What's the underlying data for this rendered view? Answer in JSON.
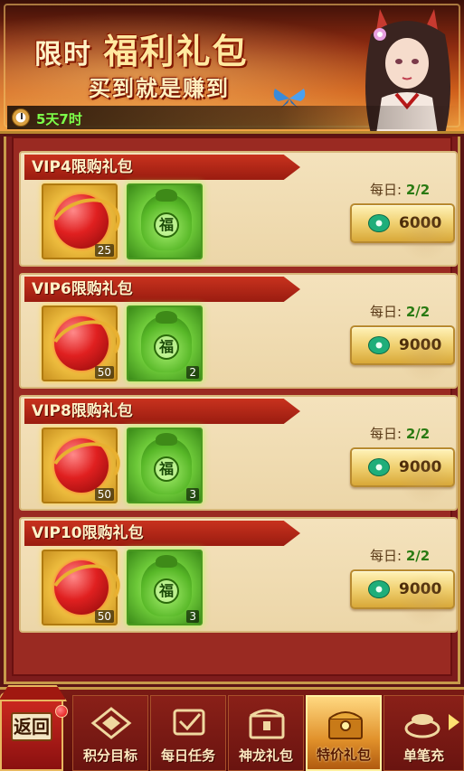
{
  "banner": {
    "title_prefix": "限时",
    "title_main": "福利礼包",
    "subtitle": "买到就是赚到",
    "timer": "5天7时"
  },
  "packs": [
    {
      "title": "VIP4限购礼包",
      "daily_label": "每日:",
      "daily_value": "2/2",
      "price": "6000",
      "items": [
        {
          "kind": "dragon-orb",
          "qty": "25"
        },
        {
          "kind": "lucky-bag",
          "qty": ""
        }
      ]
    },
    {
      "title": "VIP6限购礼包",
      "daily_label": "每日:",
      "daily_value": "2/2",
      "price": "9000",
      "items": [
        {
          "kind": "dragon-orb",
          "qty": "50"
        },
        {
          "kind": "lucky-bag",
          "qty": "2"
        }
      ]
    },
    {
      "title": "VIP8限购礼包",
      "daily_label": "每日:",
      "daily_value": "2/2",
      "price": "9000",
      "items": [
        {
          "kind": "dragon-orb",
          "qty": "50"
        },
        {
          "kind": "lucky-bag",
          "qty": "3"
        }
      ]
    },
    {
      "title": "VIP10限购礼包",
      "daily_label": "每日:",
      "daily_value": "2/2",
      "price": "9000",
      "items": [
        {
          "kind": "dragon-orb",
          "qty": "50"
        },
        {
          "kind": "lucky-bag",
          "qty": "3"
        }
      ]
    }
  ],
  "bag_glyph": "福",
  "currency_icon": "jade-coin-icon",
  "back_label": "返回",
  "nav": [
    {
      "label": "积分目标",
      "icon": "points-target-icon",
      "active": false
    },
    {
      "label": "每日任务",
      "icon": "daily-task-icon",
      "active": false
    },
    {
      "label": "神龙礼包",
      "icon": "dragon-pack-icon",
      "active": false
    },
    {
      "label": "特价礼包",
      "icon": "special-offer-icon",
      "active": true
    },
    {
      "label": "单笔充",
      "icon": "single-recharge-icon",
      "active": false
    }
  ],
  "colors": {
    "accent_red": "#9a1c10",
    "gold": "#d8a838",
    "card_bg": "#f4e2bc",
    "timer_green": "#7dff4a",
    "daily_green": "#2a7a12"
  }
}
